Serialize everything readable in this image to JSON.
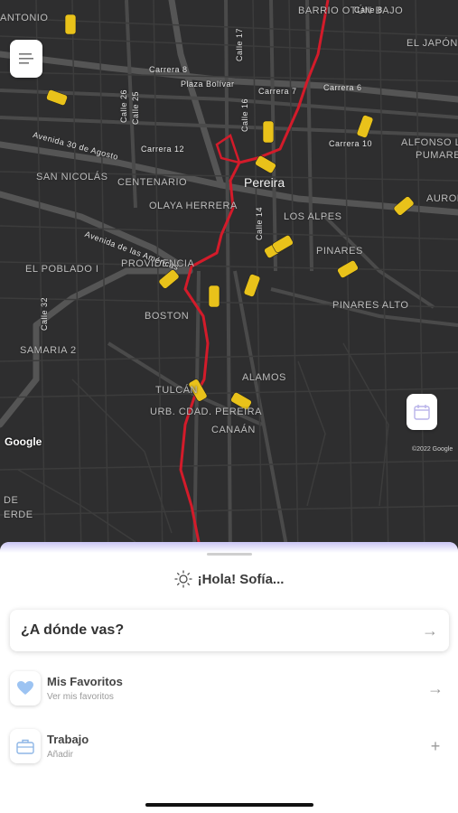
{
  "map": {
    "zones": [
      "BARRIO OTÚN BAJO",
      "EL JAPÓN",
      "SAN NICOLÁS",
      "CENTENARIO",
      "OLAYA HERRERA",
      "LOS ALPES",
      "PINARES",
      "PINARES ALTO",
      "EL POBLADO I",
      "PROVIDENCIA",
      "BOSTON",
      "SAMARIA 2",
      "ALAMOS",
      "TULCÁN",
      "URB. CDAD. PEREIRA",
      "CANAÁN",
      "ALFONSO LÓPEZ",
      "PUMAREJO",
      "AURORA",
      "ANTONIO",
      "DE",
      "ERDE"
    ],
    "city": "Pereira",
    "streets": [
      "Calle 8",
      "Carrera 8",
      "Carrera 6",
      "Carrera 7",
      "Carrera 10",
      "Carrera 12",
      "Calle 17",
      "Calle 16",
      "Calle 14",
      "Calle 26",
      "Calle 25",
      "Calle 32",
      "Avenida 30 de Agosto",
      "Avenida de las Américas",
      "Plaza Bolívar"
    ],
    "google_logo": "Google",
    "copyright": "©2022 Google"
  },
  "buttons": {
    "menu_icon": "menu-icon",
    "layers_icon": "calendar-icon"
  },
  "greeting": "¡Hola! Sofía...",
  "search": {
    "label": "¿A dónde vas?"
  },
  "list": [
    {
      "title": "Mis Favoritos",
      "subtitle": "Ver mis favoritos",
      "icon": "heart-icon",
      "action": "→"
    },
    {
      "title": "Trabajo",
      "subtitle": "Añadir",
      "icon": "briefcase-icon",
      "action": "+"
    }
  ],
  "colors": {
    "route": "#d31b2a",
    "taxi": "#e9c21a",
    "accent": "#c9c3f4",
    "map_bg": "#2e2e2f"
  }
}
